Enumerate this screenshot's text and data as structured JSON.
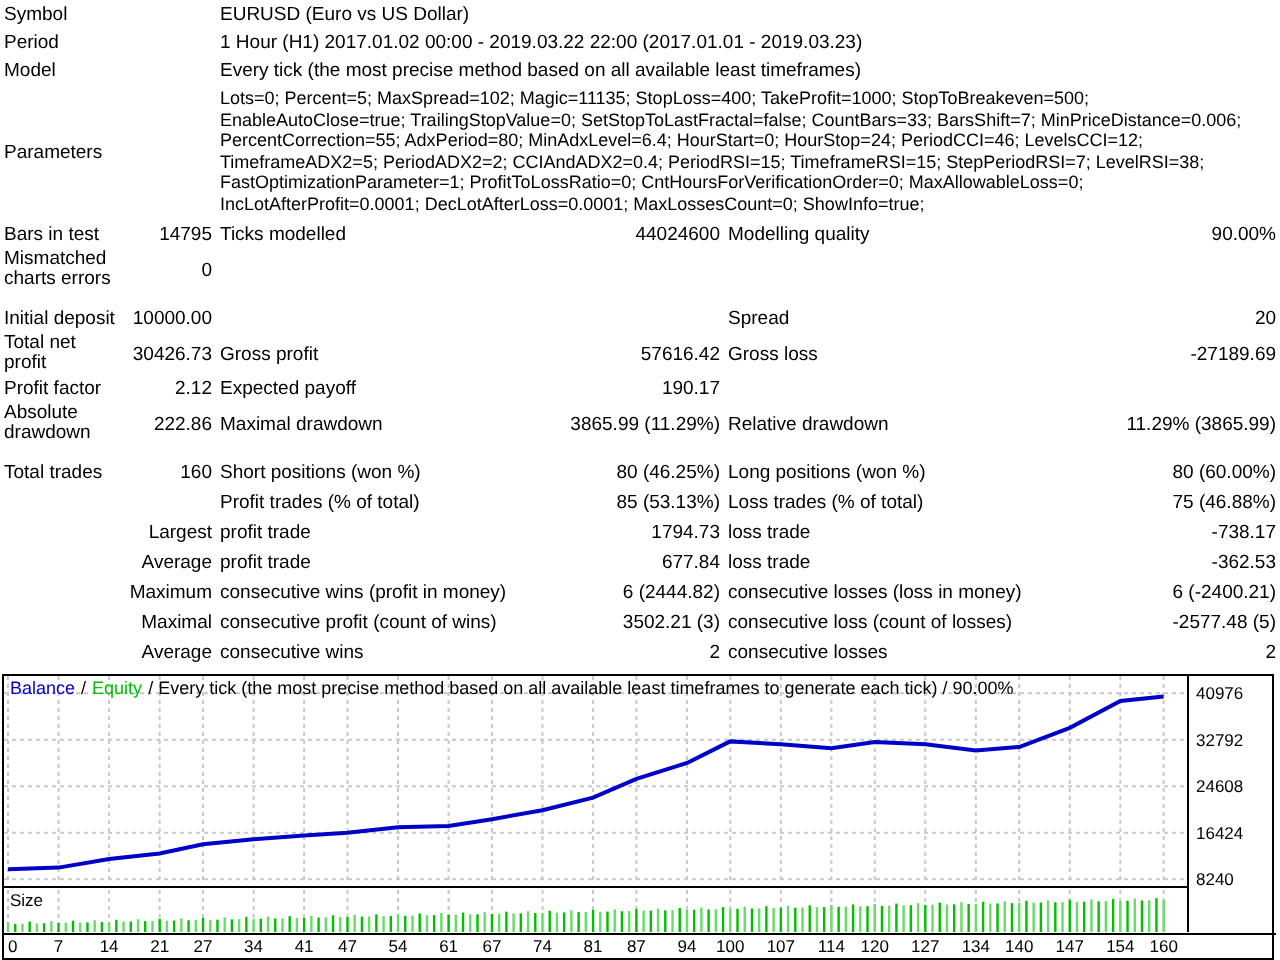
{
  "header": [
    {
      "label": "Symbol",
      "value": "EURUSD (Euro vs US Dollar)"
    },
    {
      "label": "Period",
      "value": "1 Hour (H1) 2017.01.02 00:00 - 2019.03.22 22:00 (2017.01.01 - 2019.03.23)"
    },
    {
      "label": "Model",
      "value": "Every tick (the most precise method based on all available least timeframes)"
    },
    {
      "label": "Parameters",
      "value": "Lots=0; Percent=5; MaxSpread=102; Magic=11135; StopLoss=400; TakeProfit=1000; StopToBreakeven=500; EnableAutoClose=true; TrailingStopValue=0; SetStopToLastFractal=false; CountBars=33; BarsShift=7; MinPriceDistance=0.006; PercentCorrection=55; AdxPeriod=80; MinAdxLevel=6.4; HourStart=0; HourStop=24; PeriodCCI=46; LevelsCCI=12; TimeframeADX2=5; PeriodADX2=2; CCIAndADX2=0.4; PeriodRSI=15; TimeframeRSI=15; StepPeriodRSI=7; LevelRSI=38; FastOptimizationParameter=1; ProfitToLossRatio=0; CntHoursForVerificationOrder=0; MaxAllowableLoss=0; IncLotAfterProfit=0.0001; DecLotAfterLoss=0.0001; MaxLossesCount=0; ShowInfo=true;"
    }
  ],
  "stats": [
    [
      {
        "label": "Bars in test",
        "value": "14795",
        "label_2": "Ticks modelled",
        "value_2": "44024600",
        "label_3": "Modelling quality",
        "value_3": "90.00%"
      },
      {
        "label": "Mismatched charts errors",
        "value": "0"
      }
    ],
    [
      {
        "label": "Initial deposit",
        "value": "10000.00",
        "label_3": "Spread",
        "value_3": "20"
      },
      {
        "label": "Total net profit",
        "value": "30426.73",
        "label_2": "Gross profit",
        "value_2": "57616.42",
        "label_3": "Gross loss",
        "value_3": "-27189.69"
      },
      {
        "label": "Profit factor",
        "value": "2.12",
        "label_2": "Expected payoff",
        "value_2": "190.17"
      },
      {
        "label": "Absolute drawdown",
        "value": "222.86",
        "label_2": "Maximal drawdown",
        "value_2": "3865.99 (11.29%)",
        "label_3": "Relative drawdown",
        "value_3": "11.29% (3865.99)"
      }
    ],
    [
      {
        "label": "Total trades",
        "value": "160",
        "label_2": "Short positions (won %)",
        "value_2": "80 (46.25%)",
        "label_3": "Long positions (won %)",
        "value_3": "80 (60.00%)"
      },
      {
        "label_2": "Profit trades (% of total)",
        "value_2": "85 (53.13%)",
        "label_3": "Loss trades (% of total)",
        "value_3": "75 (46.88%)"
      },
      {
        "value": "Largest",
        "label_2": "profit trade",
        "value_2": "1794.73",
        "label_3": "loss trade",
        "value_3": "-738.17"
      },
      {
        "value": "Average",
        "label_2": "profit trade",
        "value_2": "677.84",
        "label_3": "loss trade",
        "value_3": "-362.53"
      },
      {
        "value": "Maximum",
        "label_2": "consecutive wins (profit in money)",
        "value_2": "6 (2444.82)",
        "label_3": "consecutive losses (loss in money)",
        "value_3": "6 (-2400.21)"
      },
      {
        "value": "Maximal",
        "label_2": "consecutive profit (count of wins)",
        "value_2": "3502.21 (3)",
        "label_3": "consecutive loss (count of losses)",
        "value_3": "-2577.48 (5)"
      },
      {
        "value": "Average",
        "label_2": "consecutive wins",
        "value_2": "2",
        "label_3": "consecutive losses",
        "value_3": "2"
      }
    ]
  ],
  "chart": {
    "legend_separators": [
      "/"
    ],
    "legend": [
      {
        "text": "Equity",
        "color": "#00c000"
      }
    ],
    "caption": "/ Every tick (the most precise method based on all available least timeframes to generate each tick) / 90.00%",
    "size_label": "Size",
    "chart_data": {
      "type": "line",
      "x": [
        0,
        7,
        14,
        21,
        27,
        34,
        41,
        47,
        54,
        61,
        67,
        74,
        81,
        87,
        94,
        100,
        107,
        114,
        120,
        127,
        134,
        140,
        147,
        154,
        160
      ],
      "series": [
        {
          "name": "Balance",
          "color": "#0000c8",
          "values": [
            10000,
            10300,
            11800,
            12800,
            14400,
            15300,
            15900,
            16400,
            17400,
            17600,
            18800,
            20400,
            22600,
            25900,
            28700,
            32500,
            32000,
            31300,
            32400,
            32000,
            30900,
            31500,
            34900,
            39600,
            40400
          ]
        }
      ],
      "xlim": [
        0,
        175
      ],
      "ylim": [
        7400,
        44000
      ],
      "grid": true,
      "xticks": [
        0,
        7,
        14,
        21,
        27,
        34,
        41,
        47,
        54,
        61,
        67,
        74,
        81,
        87,
        94,
        100,
        107,
        114,
        120,
        127,
        134,
        140,
        147,
        154,
        160
      ],
      "yticks": [
        {
          "value": 8240,
          "label": "8240"
        },
        {
          "value": 16424,
          "label": "16424"
        },
        {
          "value": 24608,
          "label": "24608"
        },
        {
          "value": 32792,
          "label": "32792"
        },
        {
          "value": 40976,
          "label": "40976"
        }
      ]
    }
  }
}
